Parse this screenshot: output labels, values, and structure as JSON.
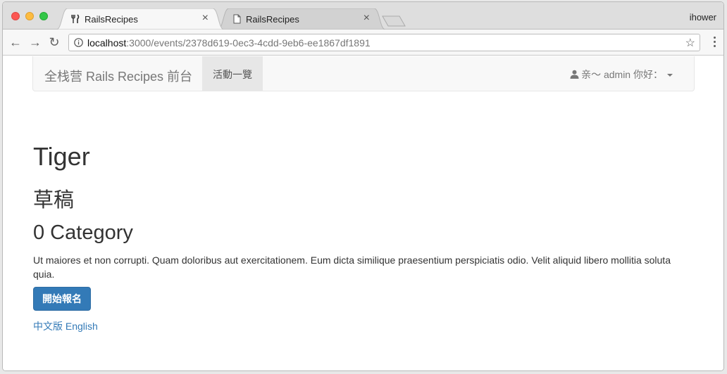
{
  "browser": {
    "profile": "ihower",
    "tabs": [
      {
        "title": "RailsRecipes",
        "icon": "utensils-icon",
        "active": true
      },
      {
        "title": "RailsRecipes",
        "icon": "page-icon",
        "active": false
      }
    ],
    "url_host": "localhost",
    "url_rest": ":3000/events/2378d619-0ec3-4cdd-9eb6-ee1867df1891"
  },
  "navbar": {
    "brand": "全栈营 Rails Recipes 前台",
    "active_item": "活動一覽",
    "user_menu": "亲～ admin 你好："
  },
  "event": {
    "title": "Tiger",
    "status": "草稿",
    "category": "0 Category",
    "description": "Ut maiores et non corrupti. Quam doloribus aut exercitationem. Eum dicta similique praesentium perspiciatis odio. Velit aliquid libero mollitia soluta quia.",
    "register_button": "開始報名",
    "lang_zh": "中文版",
    "lang_en": "English"
  },
  "colors": {
    "primary": "#337ab7",
    "navbar_bg": "#f8f8f8",
    "text": "#333333"
  }
}
